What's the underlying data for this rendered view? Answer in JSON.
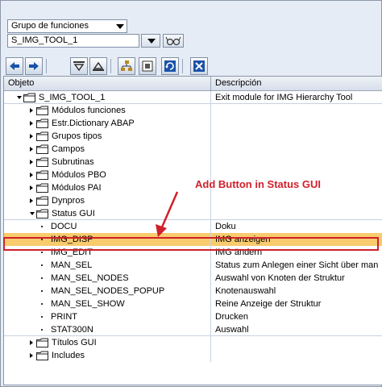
{
  "top": {
    "group_select": "Grupo de funciones",
    "object_input": "S_IMG_TOOL_1"
  },
  "toolbar": {
    "icons": [
      "back-arrow-icon",
      "forward-arrow-icon",
      "expand-icon",
      "collapse-icon",
      "hierarchy-icon",
      "select-icon",
      "refresh-icon",
      "close-icon"
    ]
  },
  "table": {
    "col_object": "Objeto",
    "col_desc": "Descripción",
    "rows": [
      {
        "label": "S_IMG_TOOL_1",
        "desc": "Exit module for IMG Hierarchy Tool"
      },
      {
        "label": "Módulos funciones",
        "desc": ""
      },
      {
        "label": "Estr.Dictionary ABAP",
        "desc": ""
      },
      {
        "label": "Grupos tipos",
        "desc": ""
      },
      {
        "label": "Campos",
        "desc": ""
      },
      {
        "label": "Subrutinas",
        "desc": ""
      },
      {
        "label": "Módulos PBO",
        "desc": ""
      },
      {
        "label": "Módulos PAI",
        "desc": ""
      },
      {
        "label": "Dynpros",
        "desc": ""
      },
      {
        "label": "Status GUI",
        "desc": ""
      },
      {
        "label": "DOCU",
        "desc": "Doku"
      },
      {
        "label": "IMG_DISP",
        "desc": "IMG anzeigen"
      },
      {
        "label": "IMG_EDIT",
        "desc": "IMG ändern"
      },
      {
        "label": "MAN_SEL",
        "desc": "Status zum Anlegen einer Sicht über man"
      },
      {
        "label": "MAN_SEL_NODES",
        "desc": "Auswahl von Knoten der Struktur"
      },
      {
        "label": "MAN_SEL_NODES_POPUP",
        "desc": "Knotenauswahl"
      },
      {
        "label": "MAN_SEL_SHOW",
        "desc": "Reine Anzeige der Struktur"
      },
      {
        "label": "PRINT",
        "desc": "Drucken"
      },
      {
        "label": "STAT300N",
        "desc": "Auswahl"
      },
      {
        "label": "Títulos GUI",
        "desc": ""
      },
      {
        "label": "Includes",
        "desc": ""
      }
    ]
  },
  "annotation": "Add Button in Status GUI",
  "colors": {
    "highlight": "#f8cb6d",
    "annotation": "#d0202b"
  }
}
